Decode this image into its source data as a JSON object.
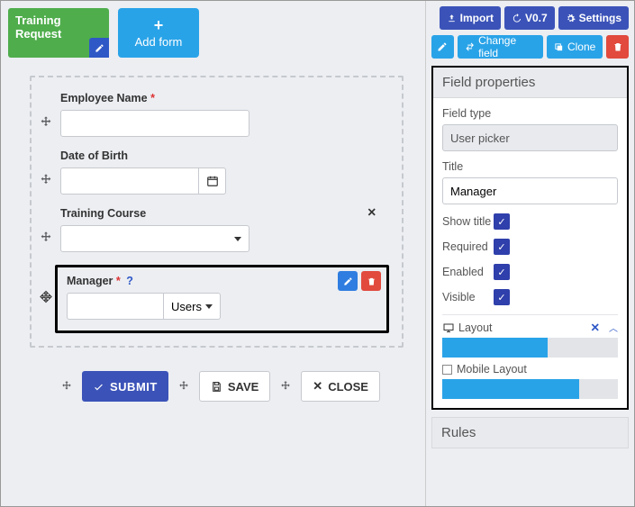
{
  "header": {
    "form_tab_label": "Training Request",
    "add_form_label": "Add form"
  },
  "fields": {
    "employee_name": {
      "label": "Employee Name",
      "required": "*"
    },
    "dob": {
      "label": "Date of Birth"
    },
    "course": {
      "label": "Training Course"
    },
    "manager": {
      "label": "Manager",
      "required": "*",
      "help": "?",
      "users_label": "Users"
    }
  },
  "buttons": {
    "submit": "Submit",
    "save": "Save",
    "close": "Close"
  },
  "toolbar": {
    "import": "Import",
    "version": "V0.7",
    "settings": "Settings",
    "change_field": "Change field",
    "clone": "Clone"
  },
  "properties": {
    "panel_title": "Field properties",
    "field_type_label": "Field type",
    "field_type_value": "User picker",
    "title_label": "Title",
    "title_value": "Manager",
    "show_title_label": "Show title",
    "required_label": "Required",
    "enabled_label": "Enabled",
    "visible_label": "Visible",
    "layout_label": "Layout",
    "mobile_layout_label": "Mobile Layout"
  },
  "rules": {
    "header": "Rules"
  }
}
